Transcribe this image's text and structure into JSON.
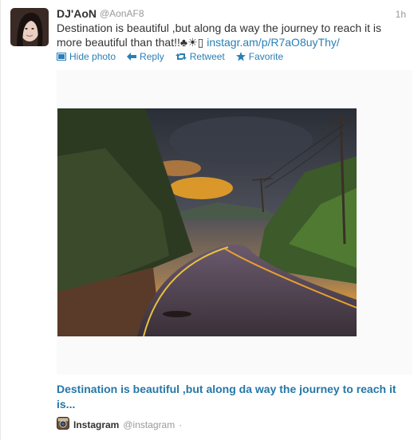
{
  "tweet": {
    "author_name": "DJ'AoN",
    "author_handle": "@AonAF8",
    "timestamp": "1h",
    "text": "Destination is beautiful ,but along da way the journey to reach it is more beautiful than that!!♣☀▯",
    "link": "instagr.am/p/R7aO8uyThy/"
  },
  "actions": {
    "hide_photo": "Hide photo",
    "reply": "Reply",
    "retweet": "Retweet",
    "favorite": "Favorite"
  },
  "card": {
    "title": "Destination is beautiful ,but along da way the journey to reach it is...",
    "source_name": "Instagram",
    "source_handle": "@instagram",
    "separator": "·"
  },
  "colors": {
    "link": "#2a7fb5",
    "card_title": "#2577a6",
    "text": "#333333",
    "muted": "#999999"
  },
  "icons": [
    "photo-icon",
    "reply-icon",
    "retweet-icon",
    "favorite-icon",
    "instagram-icon"
  ]
}
